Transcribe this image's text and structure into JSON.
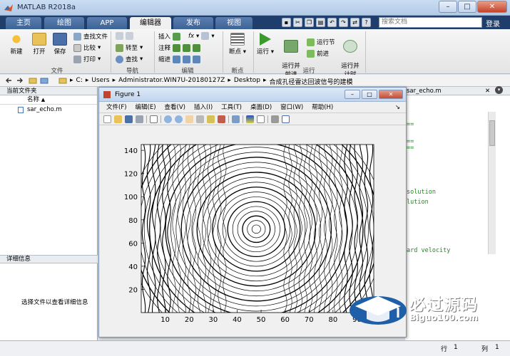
{
  "window": {
    "title": "MATLAB R2018a",
    "minimize": "–",
    "maximize": "□",
    "close": "✕"
  },
  "tabs": [
    {
      "label": "主页",
      "active": false
    },
    {
      "label": "绘图",
      "active": false
    },
    {
      "label": "APP",
      "active": false
    },
    {
      "label": "编辑器",
      "active": true
    },
    {
      "label": "发布",
      "active": false
    },
    {
      "label": "视图",
      "active": false
    }
  ],
  "search": {
    "placeholder": "搜索文档"
  },
  "login_label": "登录",
  "ribbon": {
    "file": {
      "new": "新建",
      "open": "打开",
      "save": "保存",
      "find_files": "查找文件",
      "compare": "比较",
      "print": "打印",
      "group": "文件"
    },
    "navigate": {
      "goto": "转至",
      "find": "查找",
      "group": "导航"
    },
    "edit": {
      "insert": "插入",
      "comment": "注释",
      "indent": "缩进",
      "fx": "fx",
      "group": "编辑"
    },
    "breakpoints": {
      "breakpoints": "断点",
      "group": "断点"
    },
    "run": {
      "run": "运行",
      "run_advance": "运行并\n前进",
      "run_section": "运行节",
      "advance": "前进",
      "run_time": "运行并\n计时",
      "group": "运行"
    }
  },
  "path": {
    "segments": [
      "C:",
      "Users",
      "Administrator.WIN7U-20180127Z",
      "Desktop",
      "合成孔径雷达回波信号的建模"
    ]
  },
  "current_folder": {
    "title": "当前文件夹",
    "col_name": "名称",
    "sort_arrow": "▲",
    "files": [
      "sar_echo.m"
    ]
  },
  "details": {
    "title": "详细信息",
    "hint": "选择文件以查看详细信息"
  },
  "editor": {
    "tab": "sar_echo.m",
    "lines": [
      {
        "text": "==",
        "color": "#228b22"
      },
      {
        "text": "==",
        "color": "#228b22"
      },
      {
        "text": "==",
        "color": "#228b22"
      },
      {
        "text": "solution",
        "color": "#228b22"
      },
      {
        "text": "lution",
        "color": "#228b22"
      },
      {
        "text": "ard velocity",
        "color": "#228b22"
      }
    ]
  },
  "status": {
    "row_label": "行",
    "row_value": "1",
    "col_label": "列",
    "col_value": "1"
  },
  "figure": {
    "title": "Figure 1",
    "menu": [
      "文件(F)",
      "编辑(E)",
      "查看(V)",
      "插入(I)",
      "工具(T)",
      "桌面(D)",
      "窗口(W)",
      "帮助(H)"
    ],
    "menu_arrow": "↘"
  },
  "chart_data": {
    "type": "contour",
    "title": "",
    "xlabel": "",
    "ylabel": "",
    "xlim": [
      0,
      97
    ],
    "ylim": [
      0,
      145
    ],
    "x_ticks": [
      10,
      20,
      30,
      40,
      50,
      60,
      70,
      80,
      90
    ],
    "y_ticks": [
      20,
      40,
      60,
      80,
      100,
      120,
      140
    ],
    "center": [
      48,
      72
    ],
    "grid": false
  },
  "watermark": {
    "big": "必过源码",
    "small": "Biguo100.com"
  }
}
